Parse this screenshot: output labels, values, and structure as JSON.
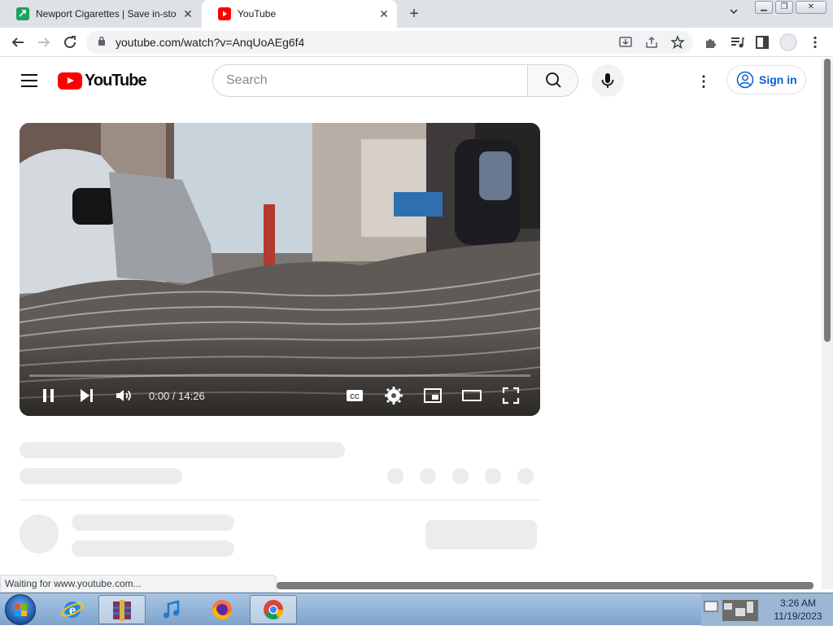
{
  "browser": {
    "tabs": [
      {
        "title": "Newport Cigarettes | Save in-sto",
        "favicon": "newport-favicon",
        "color": "#1aa260"
      },
      {
        "title": "YouTube",
        "favicon": "youtube-favicon",
        "color": "#ff0000"
      }
    ],
    "new_tab": "+",
    "url": "youtube.com/watch?v=AnqUoAEg6f4"
  },
  "youtube": {
    "logo_text": "YouTube",
    "search_placeholder": "Search",
    "sign_in": "Sign in"
  },
  "player": {
    "time": "0:00 / 14:26",
    "progress_fraction": 0.0,
    "state": "playing"
  },
  "status": {
    "text": "Waiting for www.youtube.com..."
  },
  "taskbar": {
    "apps": [
      "start-orb",
      "internet-explorer-icon",
      "winrar-icon",
      "itunes-icon",
      "firefox-icon",
      "chrome-icon"
    ],
    "time": "3:26 AM",
    "date": "11/19/2023"
  },
  "colors": {
    "youtube_red": "#ff0000",
    "link_blue": "#065fd4",
    "load_bar": "#e53935"
  }
}
